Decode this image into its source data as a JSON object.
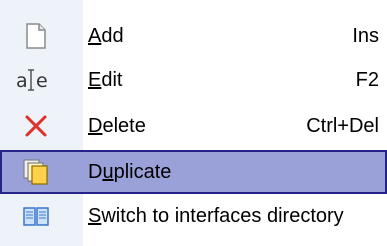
{
  "menu": {
    "items": [
      {
        "pre": "",
        "accel": "A",
        "post": "dd",
        "shortcut": "Ins",
        "icon": "new-document-icon"
      },
      {
        "pre": "",
        "accel": "E",
        "post": "dit",
        "shortcut": "F2",
        "icon": "edit-text-icon"
      },
      {
        "pre": "",
        "accel": "D",
        "post": "elete",
        "shortcut": "Ctrl+Del",
        "icon": "delete-x-icon"
      },
      {
        "pre": "D",
        "accel": "u",
        "post": "plicate",
        "shortcut": "",
        "icon": "duplicate-icon"
      },
      {
        "pre": "",
        "accel": "S",
        "post": "witch to interfaces directory",
        "shortcut": "",
        "icon": "book-icon"
      }
    ],
    "selected_index": 3,
    "colors": {
      "selected_bg": "#9aa0d8",
      "selected_border": "#23238a",
      "gutter_bg": "#eef3fa",
      "delete_icon": "#e0302a",
      "book_icon": "#3a78c8"
    }
  }
}
